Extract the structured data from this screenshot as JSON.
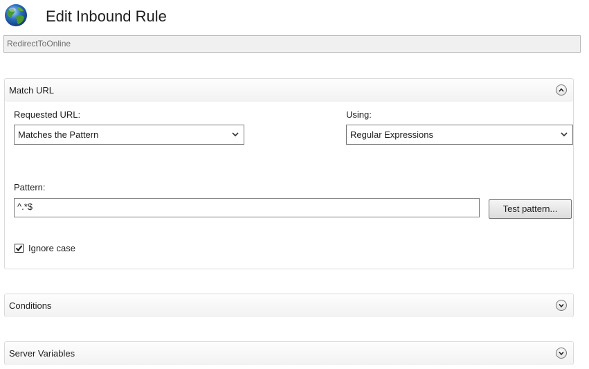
{
  "header": {
    "title": "Edit Inbound Rule",
    "rule_name": "RedirectToOnline",
    "icon": "globe-icon"
  },
  "match_url": {
    "title": "Match URL",
    "expanded": true,
    "requested_url_label": "Requested URL:",
    "requested_url_value": "Matches the Pattern",
    "using_label": "Using:",
    "using_value": "Regular Expressions",
    "pattern_label": "Pattern:",
    "pattern_value": "^.*$",
    "test_button": "Test pattern...",
    "ignore_case_label": "Ignore case",
    "ignore_case_checked": true
  },
  "conditions": {
    "title": "Conditions",
    "expanded": false
  },
  "server_variables": {
    "title": "Server Variables",
    "expanded": false
  },
  "colors": {
    "section_border": "#dadada",
    "field_border": "#7a7a7a",
    "globe_blue": "#2a6fc0",
    "globe_green": "#4a9a2e"
  }
}
